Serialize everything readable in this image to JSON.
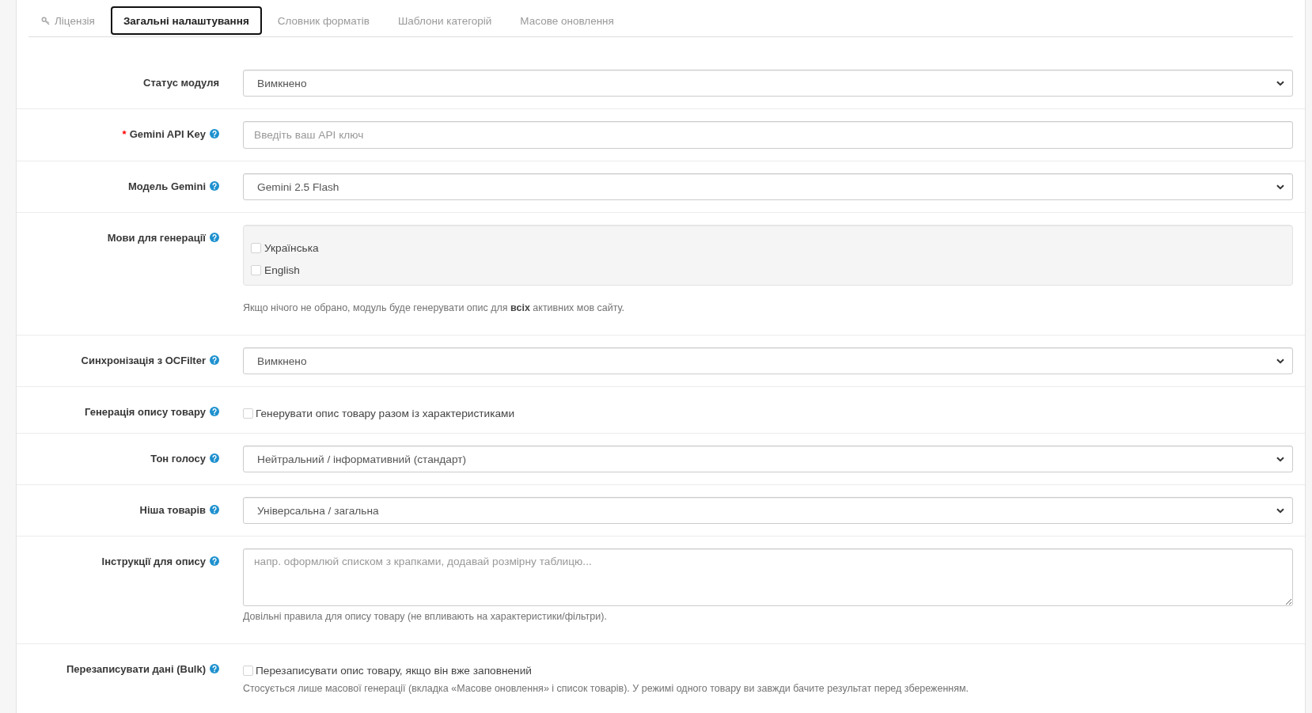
{
  "tabs": [
    {
      "label": "Ліцензія",
      "icon": true,
      "selected": false
    },
    {
      "label": "Загальні налаштування",
      "icon": false,
      "selected": true
    },
    {
      "label": "Словник форматів",
      "icon": false,
      "selected": false
    },
    {
      "label": "Шаблони категорій",
      "icon": false,
      "selected": false
    },
    {
      "label": "Масове оновлення",
      "icon": false,
      "selected": false
    }
  ],
  "form": {
    "rows": [
      {
        "kind": "select",
        "label": "Статус модуля",
        "help": false,
        "value": "Вимкнено"
      },
      {
        "kind": "input",
        "required_mark": "*",
        "label": "Gemini API Key",
        "help": true,
        "placeholder": "Введіть ваш API ключ"
      },
      {
        "kind": "select",
        "label": "Модель Gemini",
        "help": true,
        "value": "Gemini 2.5 Flash"
      },
      {
        "kind": "checklist",
        "label": "Мови для генерації",
        "help": true,
        "options": [
          {
            "label": "Українська",
            "checked": false
          },
          {
            "label": "English",
            "checked": false
          }
        ],
        "note": "Якщо нічого не обрано, модуль буде генерувати опис для **всіх** активних мов сайту."
      },
      {
        "kind": "select",
        "label": "Синхронізація з OCFilter",
        "help": true,
        "value": "Вимкнено"
      },
      {
        "kind": "checkbox",
        "label": "Генерація опису товару",
        "help": true,
        "option": {
          "label": "Генерувати опис товару разом із характеристиками",
          "checked": false
        }
      },
      {
        "kind": "select",
        "label": "Тон голосу",
        "help": true,
        "value": "Нейтральний / інформативний (стандарт)"
      },
      {
        "kind": "select",
        "label": "Ніша товарів",
        "help": true,
        "value": "Універсальна / загальна"
      },
      {
        "kind": "textarea",
        "label": "Інструкції для опису",
        "help": true,
        "placeholder": "напр. оформлюй списком з крапками, додавай розмірну таблицю...",
        "note": "Довільні правила для опису товару (не впливають на характеристики/фільтри)."
      },
      {
        "kind": "checkbox",
        "label": "Перезаписувати дані (Bulk)",
        "help": true,
        "option": {
          "label": "Перезаписувати опис товару, якщо він вже заповнений",
          "checked": false
        },
        "note": "Стосується лише масової генерації (вкладка «Масове оновлення» і список товарів). У режимі одного товару ви завжди бачите результат перед збереженням."
      }
    ]
  }
}
